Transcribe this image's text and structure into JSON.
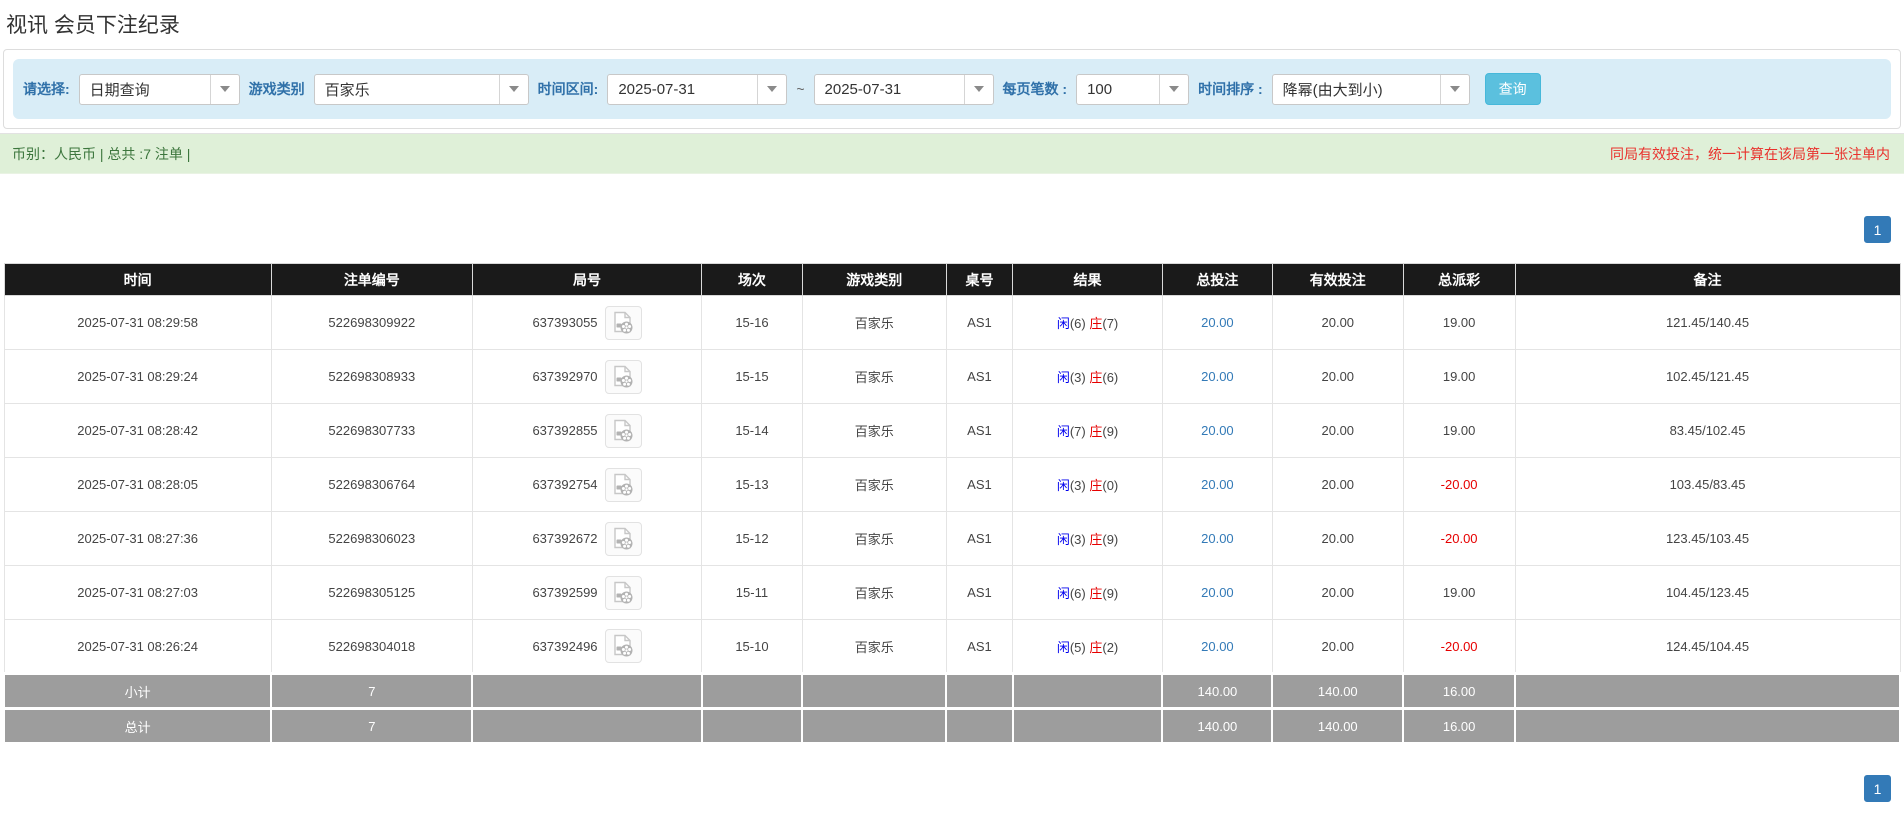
{
  "page": {
    "title": "视讯 会员下注纪录"
  },
  "filters": {
    "select_label": "请选择:",
    "select_value": "日期查询",
    "game_type_label": "游戏类别",
    "game_type_value": "百家乐",
    "date_range_label": "时间区间:",
    "date_from": "2025-07-31",
    "date_separator": "~",
    "date_to": "2025-07-31",
    "page_size_label": "每页笔数 :",
    "page_size_value": "100",
    "sort_label": "时间排序 :",
    "sort_value": "降幂(由大到小)",
    "search_button": "查询"
  },
  "summary": {
    "left_text": "币别：人民币 | 总共 :7 注单 |",
    "right_text": "同局有效投注，统一计算在该局第一张注单内"
  },
  "pagination": {
    "page": "1"
  },
  "icons": {
    "combo_caret": "chevron-down-icon",
    "round_video": "video-record-icon"
  },
  "colors": {
    "accent_blue": "#337ab7",
    "search_button": "#5bc0de",
    "filter_bg": "#d9edf7",
    "summary_bg": "#dff0d8",
    "summary_text": "#3c763d",
    "notice_red": "#e9322d",
    "table_header_bg": "#1a1a1a",
    "totals_bg": "#9d9d9d",
    "player_blue": "#0000ee",
    "banker_red": "#e60000"
  },
  "table": {
    "headers": [
      "时间",
      "注单编号",
      "局号",
      "场次",
      "游戏类别",
      "桌号",
      "结果",
      "总投注",
      "有效投注",
      "总派彩",
      "备注"
    ],
    "rows": [
      {
        "time": "2025-07-31 08:29:58",
        "bet_id": "522698309922",
        "round_id": "637393055",
        "session": "15-16",
        "game": "百家乐",
        "table_no": "AS1",
        "player": "闲",
        "player_num": "(6)",
        "banker": "庄",
        "banker_num": "(7)",
        "total_bet": "20.00",
        "valid_bet": "20.00",
        "payout": "19.00",
        "remark": "121.45/140.45"
      },
      {
        "time": "2025-07-31 08:29:24",
        "bet_id": "522698308933",
        "round_id": "637392970",
        "session": "15-15",
        "game": "百家乐",
        "table_no": "AS1",
        "player": "闲",
        "player_num": "(3)",
        "banker": "庄",
        "banker_num": "(6)",
        "total_bet": "20.00",
        "valid_bet": "20.00",
        "payout": "19.00",
        "remark": "102.45/121.45"
      },
      {
        "time": "2025-07-31 08:28:42",
        "bet_id": "522698307733",
        "round_id": "637392855",
        "session": "15-14",
        "game": "百家乐",
        "table_no": "AS1",
        "player": "闲",
        "player_num": "(7)",
        "banker": "庄",
        "banker_num": "(9)",
        "total_bet": "20.00",
        "valid_bet": "20.00",
        "payout": "19.00",
        "remark": "83.45/102.45"
      },
      {
        "time": "2025-07-31 08:28:05",
        "bet_id": "522698306764",
        "round_id": "637392754",
        "session": "15-13",
        "game": "百家乐",
        "table_no": "AS1",
        "player": "闲",
        "player_num": "(3)",
        "banker": "庄",
        "banker_num": "(0)",
        "total_bet": "20.00",
        "valid_bet": "20.00",
        "payout": "-20.00",
        "remark": "103.45/83.45"
      },
      {
        "time": "2025-07-31 08:27:36",
        "bet_id": "522698306023",
        "round_id": "637392672",
        "session": "15-12",
        "game": "百家乐",
        "table_no": "AS1",
        "player": "闲",
        "player_num": "(3)",
        "banker": "庄",
        "banker_num": "(9)",
        "total_bet": "20.00",
        "valid_bet": "20.00",
        "payout": "-20.00",
        "remark": "123.45/103.45"
      },
      {
        "time": "2025-07-31 08:27:03",
        "bet_id": "522698305125",
        "round_id": "637392599",
        "session": "15-11",
        "game": "百家乐",
        "table_no": "AS1",
        "player": "闲",
        "player_num": "(6)",
        "banker": "庄",
        "banker_num": "(9)",
        "total_bet": "20.00",
        "valid_bet": "20.00",
        "payout": "19.00",
        "remark": "104.45/123.45"
      },
      {
        "time": "2025-07-31 08:26:24",
        "bet_id": "522698304018",
        "round_id": "637392496",
        "session": "15-10",
        "game": "百家乐",
        "table_no": "AS1",
        "player": "闲",
        "player_num": "(5)",
        "banker": "庄",
        "banker_num": "(2)",
        "total_bet": "20.00",
        "valid_bet": "20.00",
        "payout": "-20.00",
        "remark": "124.45/104.45"
      }
    ],
    "subtotal": {
      "label": "小计",
      "count": "7",
      "total_bet": "140.00",
      "valid_bet": "140.00",
      "payout": "16.00"
    },
    "total": {
      "label": "总计",
      "count": "7",
      "total_bet": "140.00",
      "valid_bet": "140.00",
      "payout": "16.00"
    }
  }
}
